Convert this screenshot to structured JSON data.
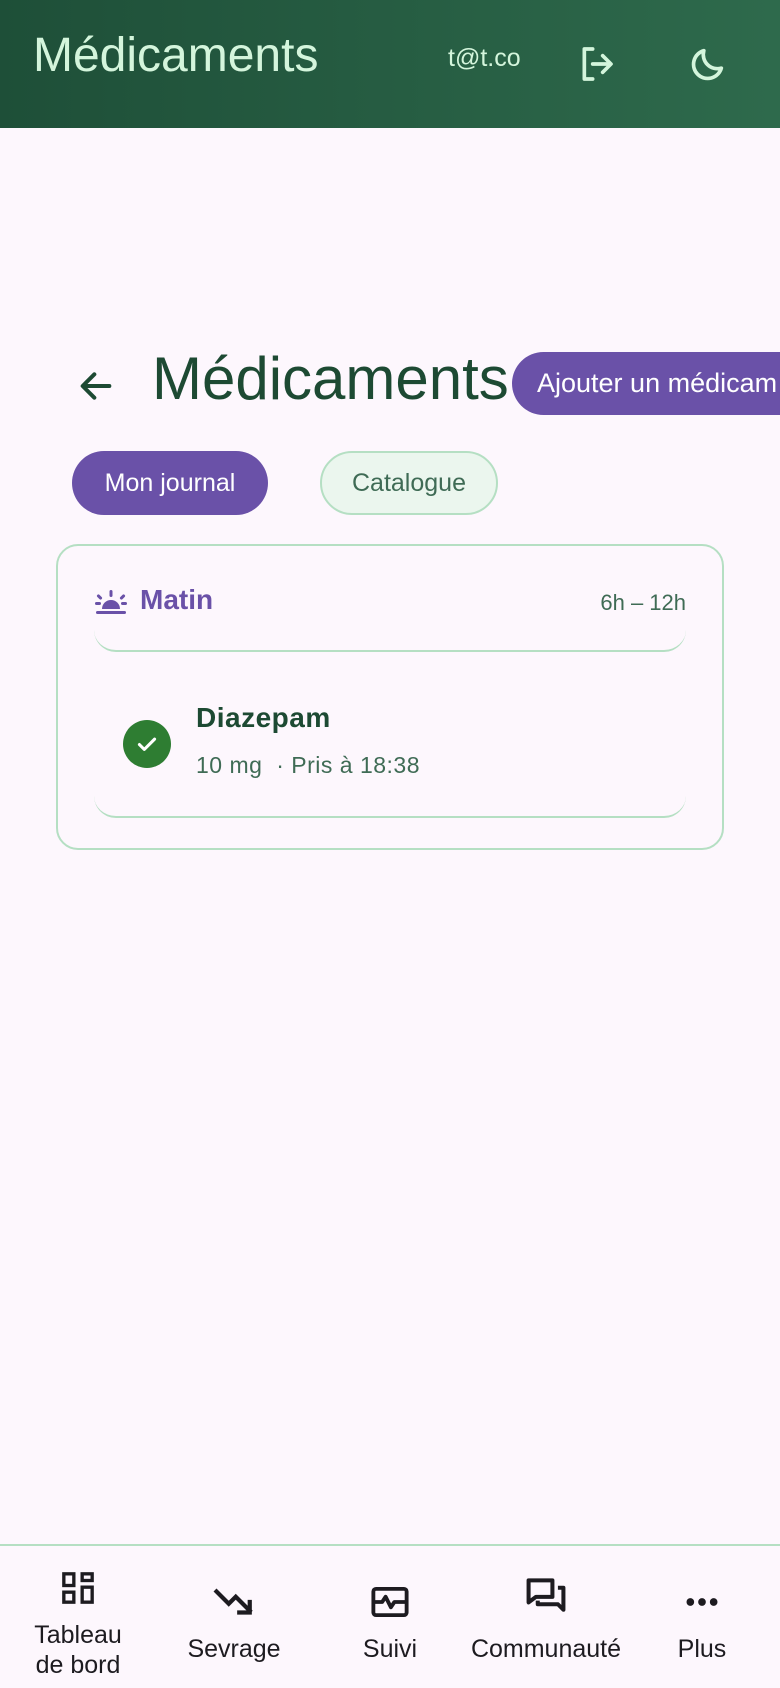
{
  "header": {
    "title": "Médicaments",
    "email": "t@t.co",
    "logout_icon": "logout-icon",
    "theme_icon": "moon-icon"
  },
  "page": {
    "title": "Médicaments",
    "add_button": "Ajouter un médicam"
  },
  "tabs": [
    {
      "label": "Mon journal",
      "selected": true
    },
    {
      "label": "Catalogue",
      "selected": false
    }
  ],
  "journal": {
    "period": {
      "name": "Matin",
      "range": "6h – 12h",
      "icon": "sunrise-icon"
    },
    "items": [
      {
        "name": "Diazepam",
        "dose": "10 mg",
        "status": "· Pris à 18:38",
        "taken": true
      }
    ]
  },
  "nav": {
    "items": [
      {
        "label_line1": "Tableau",
        "label_line2": "de bord",
        "icon": "dashboard-icon"
      },
      {
        "label": "Sevrage",
        "icon": "trending-down-icon"
      },
      {
        "label": "Suivi",
        "icon": "monitor-heart-icon"
      },
      {
        "label": "Communauté",
        "icon": "forum-icon"
      },
      {
        "label": "Plus",
        "icon": "more-horiz-icon"
      }
    ]
  },
  "colors": {
    "header_start": "#1e4f38",
    "header_end": "#2e6a4c",
    "accent": "#6a51a8",
    "success": "#2e7d32",
    "border": "#b5dfc3",
    "background": "#fdf7fd"
  }
}
